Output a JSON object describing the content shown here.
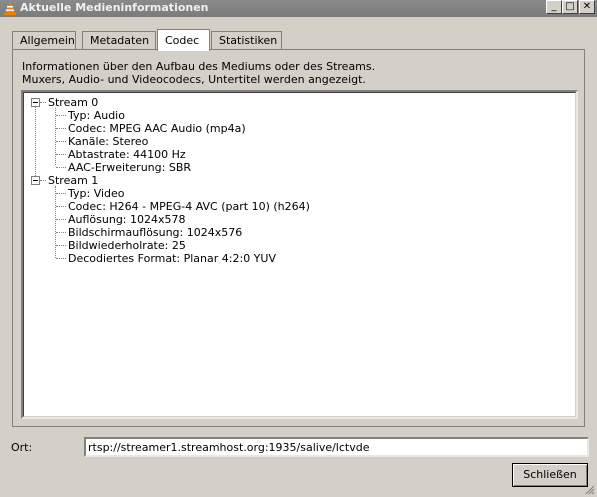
{
  "window": {
    "title": "Aktuelle Medieninformationen",
    "buttons": [
      "_",
      "□",
      "✕"
    ]
  },
  "tabs": [
    {
      "label": "Allgemein",
      "active": false
    },
    {
      "label": "Metadaten",
      "active": false
    },
    {
      "label": "Codec",
      "active": true
    },
    {
      "label": "Statistiken",
      "active": false
    }
  ],
  "codec": {
    "info_line1": "Informationen über den Aufbau des Mediums oder des Streams.",
    "info_line2": "Muxers, Audio- und Videocodecs, Untertitel werden angezeigt.",
    "streams": [
      {
        "label": "Stream 0",
        "items": [
          "Typ: Audio",
          "Codec: MPEG AAC Audio (mp4a)",
          "Kanäle: Stereo",
          "Abtastrate: 44100 Hz",
          "AAC-Erweiterung: SBR"
        ]
      },
      {
        "label": "Stream 1",
        "items": [
          "Typ: Video",
          "Codec: H264 - MPEG-4 AVC (part 10) (h264)",
          "Auflösung: 1024x578",
          "Bildschirmauflösung: 1024x576",
          "Bildwiederholrate: 25",
          "Decodiertes Format: Planar 4:2:0 YUV"
        ]
      }
    ]
  },
  "location": {
    "label": "Ort:",
    "value": "rtsp://streamer1.streamhost.org:1935/salive/lctvde"
  },
  "close_label": "Schließen",
  "colors": {
    "window_bg": "#d4d0c8",
    "titlebar": "#7b7b7b",
    "icon_orange": "#f08000"
  }
}
